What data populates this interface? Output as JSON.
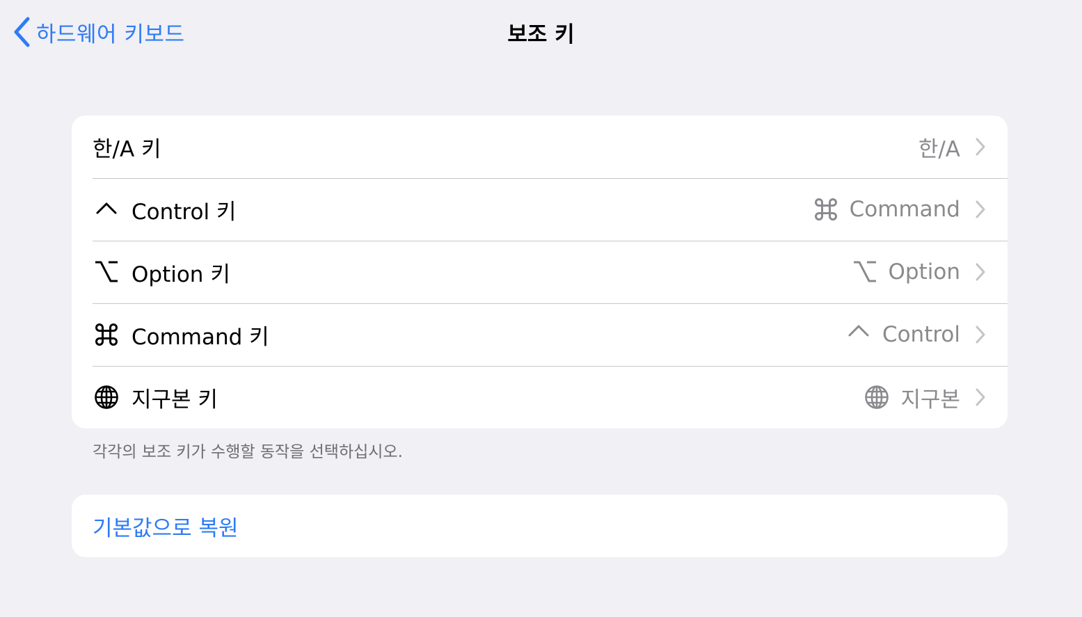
{
  "navbar": {
    "back_label": "하드웨어 키보드",
    "title": "보조 키"
  },
  "modifier_keys": [
    {
      "icon": "none",
      "label": "한/A 키",
      "value_icon": "none",
      "value": "한/A"
    },
    {
      "icon": "control-caret-icon",
      "label": "Control 키",
      "value_icon": "command-icon",
      "value": "Command"
    },
    {
      "icon": "option-icon",
      "label": "Option 키",
      "value_icon": "option-icon",
      "value": "Option"
    },
    {
      "icon": "command-icon",
      "label": "Command 키",
      "value_icon": "control-caret-icon",
      "value": "Control"
    },
    {
      "icon": "globe-icon",
      "label": "지구본 키",
      "value_icon": "globe-icon",
      "value": "지구본"
    }
  ],
  "footnote": "각각의 보조 키가 수행할 동작을 선택하십시오.",
  "restore": {
    "label": "기본값으로 복원"
  },
  "colors": {
    "accent": "#2f7bf5",
    "background": "#f0f0f5",
    "secondary_text": "#8a8a8e",
    "separator": "#c8c8cc"
  }
}
